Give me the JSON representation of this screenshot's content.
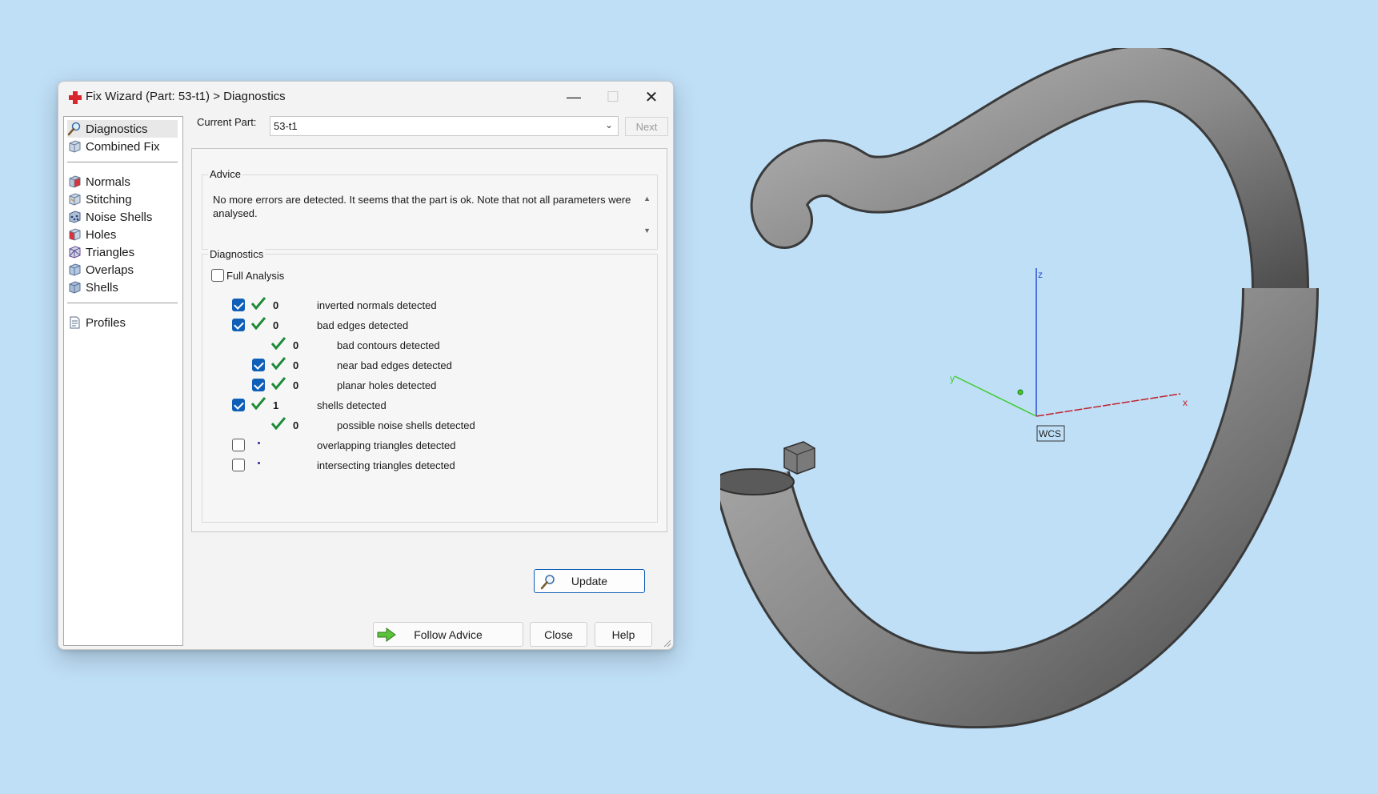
{
  "window": {
    "title": "Fix Wizard (Part: 53-t1) > Diagnostics",
    "minimize": "—",
    "maximize": "☐",
    "close": "✕"
  },
  "nav": {
    "items": [
      {
        "label": "Diagnostics",
        "icon": "magnifier-icon",
        "selected": true
      },
      {
        "label": "Combined Fix",
        "icon": "cube-icon"
      },
      {
        "label": "Normals",
        "icon": "cube-icon"
      },
      {
        "label": "Stitching",
        "icon": "cube-icon"
      },
      {
        "label": "Noise Shells",
        "icon": "cube-icon"
      },
      {
        "label": "Holes",
        "icon": "cube-icon"
      },
      {
        "label": "Triangles",
        "icon": "cube-icon"
      },
      {
        "label": "Overlaps",
        "icon": "cube-icon"
      },
      {
        "label": "Shells",
        "icon": "cube-icon"
      },
      {
        "label": "Profiles",
        "icon": "document-icon"
      }
    ]
  },
  "current_part": {
    "label": "Current Part:",
    "value": "53-t1",
    "next_label": "Next"
  },
  "advice": {
    "title": "Advice",
    "text": "No more errors are detected. It seems that the part is ok. Note that not all parameters were analysed."
  },
  "diagnostics": {
    "title": "Diagnostics",
    "full_analysis_label": "Full Analysis",
    "full_analysis_checked": false,
    "rows": [
      {
        "checkbox": true,
        "checked": true,
        "status": "ok",
        "count": "0",
        "label": "inverted normals detected",
        "indent": 0
      },
      {
        "checkbox": true,
        "checked": true,
        "status": "ok",
        "count": "0",
        "label": "bad edges detected",
        "indent": 0
      },
      {
        "checkbox": false,
        "checked": false,
        "status": "ok",
        "count": "0",
        "label": "bad contours detected",
        "indent": 1
      },
      {
        "checkbox": true,
        "checked": true,
        "status": "ok",
        "count": "0",
        "label": "near bad edges detected",
        "indent": 1
      },
      {
        "checkbox": true,
        "checked": true,
        "status": "ok",
        "count": "0",
        "label": "planar holes detected",
        "indent": 1
      },
      {
        "checkbox": true,
        "checked": true,
        "status": "ok",
        "count": "1",
        "label": "shells detected",
        "indent": 0
      },
      {
        "checkbox": false,
        "checked": false,
        "status": "ok",
        "count": "0",
        "label": "possible noise shells detected",
        "indent": 1
      },
      {
        "checkbox": true,
        "checked": false,
        "status": "none",
        "count": "",
        "label": "overlapping triangles detected",
        "indent": 0
      },
      {
        "checkbox": true,
        "checked": false,
        "status": "none",
        "count": "",
        "label": "intersecting triangles detected",
        "indent": 0
      }
    ],
    "update_label": "Update"
  },
  "footer": {
    "follow_advice_label": "Follow Advice",
    "close_label": "Close",
    "help_label": "Help"
  },
  "viewport": {
    "axis_x": "x",
    "axis_y": "y",
    "axis_z": "z",
    "wcs_label": "WCS"
  },
  "colors": {
    "background": "#bfdff7",
    "check_blue": "#0f5fb8",
    "tick_green": "#1f8a3a",
    "axis_x": "#c0202a",
    "axis_y": "#3fcc2a",
    "axis_z": "#2a4fd0"
  }
}
